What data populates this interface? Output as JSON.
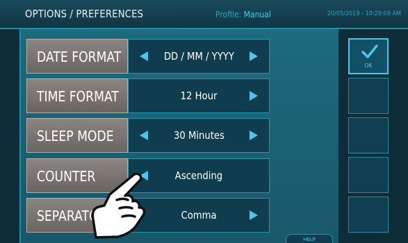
{
  "header": {
    "title": "OPTIONS / PREFERENCES",
    "profile_label": "Profile:",
    "profile_value": "Manual",
    "datetime": "20/05/2019 - 10:29:09 AM"
  },
  "settings": [
    {
      "label": "DATE FORMAT",
      "value": "DD / MM / YYYY",
      "has_left_arrow": true,
      "has_right_arrow": true
    },
    {
      "label": "TIME FORMAT",
      "value": "12 Hour",
      "has_left_arrow": false,
      "has_right_arrow": true
    },
    {
      "label": "SLEEP MODE",
      "value": "30 Minutes",
      "has_left_arrow": true,
      "has_right_arrow": true
    },
    {
      "label": "COUNTER",
      "value": "Ascending",
      "has_left_arrow": true,
      "has_right_arrow": false
    },
    {
      "label": "SEPARATOR",
      "value": "Comma",
      "has_left_arrow": false,
      "has_right_arrow": true
    }
  ],
  "side_buttons": {
    "ok_label": "OK"
  },
  "footer": {
    "help_label": "HELP"
  },
  "icons": {
    "prev": "triangle-left-icon",
    "next": "triangle-right-icon",
    "ok": "checkmark-icon",
    "pointer": "pointing-hand-icon"
  },
  "colors": {
    "accent": "#4cc6ec",
    "header_text": "#e6f3f6",
    "label_bg": "#7a7570",
    "value_bg": "#0f3d4f",
    "panel_bg": "#1d6a7e"
  }
}
